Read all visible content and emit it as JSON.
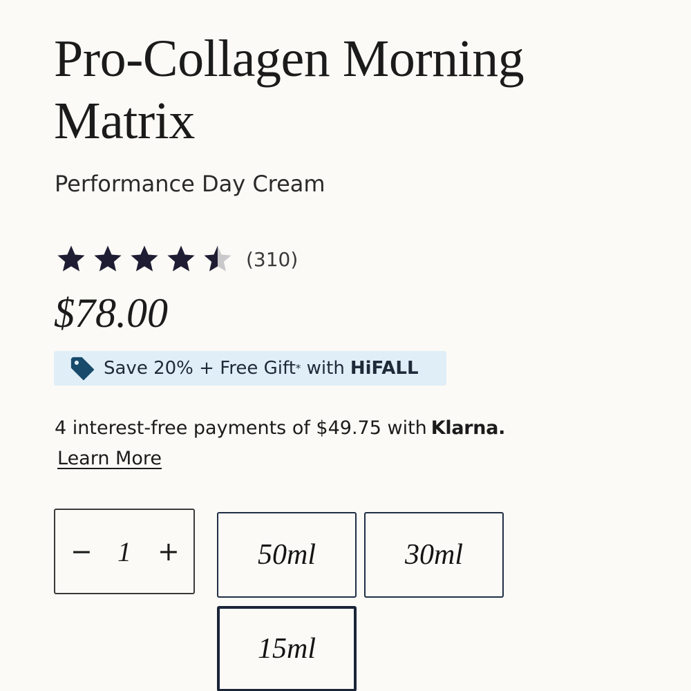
{
  "product": {
    "title_line1": "Pro-Collagen Morning",
    "title_line2": "Matrix",
    "subtitle": "Performance Day Cream",
    "rating": 4.5,
    "review_count": "(310)",
    "price": "$78.00"
  },
  "promo": {
    "icon": "price-tag-icon",
    "text": "Save 20% + Free Gift",
    "asterisk": "*",
    "with": "with",
    "code": "HiFALL"
  },
  "klarna": {
    "text": "4 interest-free payments of $49.75 with",
    "logo": "Klarna.",
    "learn_more": "Learn More"
  },
  "quantity": {
    "minus": "−",
    "value": "1",
    "plus": "+"
  },
  "sizes": [
    {
      "label": "50ml"
    },
    {
      "label": "30ml"
    },
    {
      "label": "15ml"
    }
  ],
  "selected_size": "15ml",
  "colors": {
    "star_filled": "#1f1d33",
    "star_empty": "#c9c9cc",
    "promo_bg": "#dfeef7",
    "tag_icon": "#174a6b",
    "size_border": "#1f2d45"
  }
}
